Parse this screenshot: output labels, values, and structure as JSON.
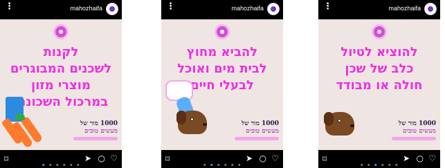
{
  "posts": [
    {
      "username": "mahozhaifa",
      "lines": [
        "לקנות",
        "לשכנים המבוגרים",
        "מוצרי מזון",
        "במרכול השכונתי"
      ],
      "logo": {
        "top": "1000 מור של",
        "middle": "מעשים טובים"
      },
      "dots_active_index": 0
    },
    {
      "username": "mahozhaifa",
      "lines": [
        "להביא מחוץ",
        "לבית מים ואוכל",
        "לבעלי חיים"
      ],
      "logo": {
        "top": "1000 מור של",
        "middle": "מעשים טובים"
      },
      "dots_active_index": 1
    },
    {
      "username": "mahozhaifa",
      "lines": [
        "להוציא לטיול",
        "כלב של שכן",
        "חולה או מבודד"
      ],
      "logo": {
        "top": "1000 מור של",
        "middle": "מעשים טובים"
      },
      "dots_active_index": 2
    }
  ],
  "icons": {
    "more": "more-vertical-icon",
    "avatar": "profile-avatar",
    "save": "bookmark-icon",
    "send": "send-icon",
    "comment": "comment-icon",
    "like": "heart-icon"
  },
  "colors": {
    "headline_pink": "#ee2fe0",
    "card_background": "#efe5e2",
    "frame_black": "#000000"
  }
}
